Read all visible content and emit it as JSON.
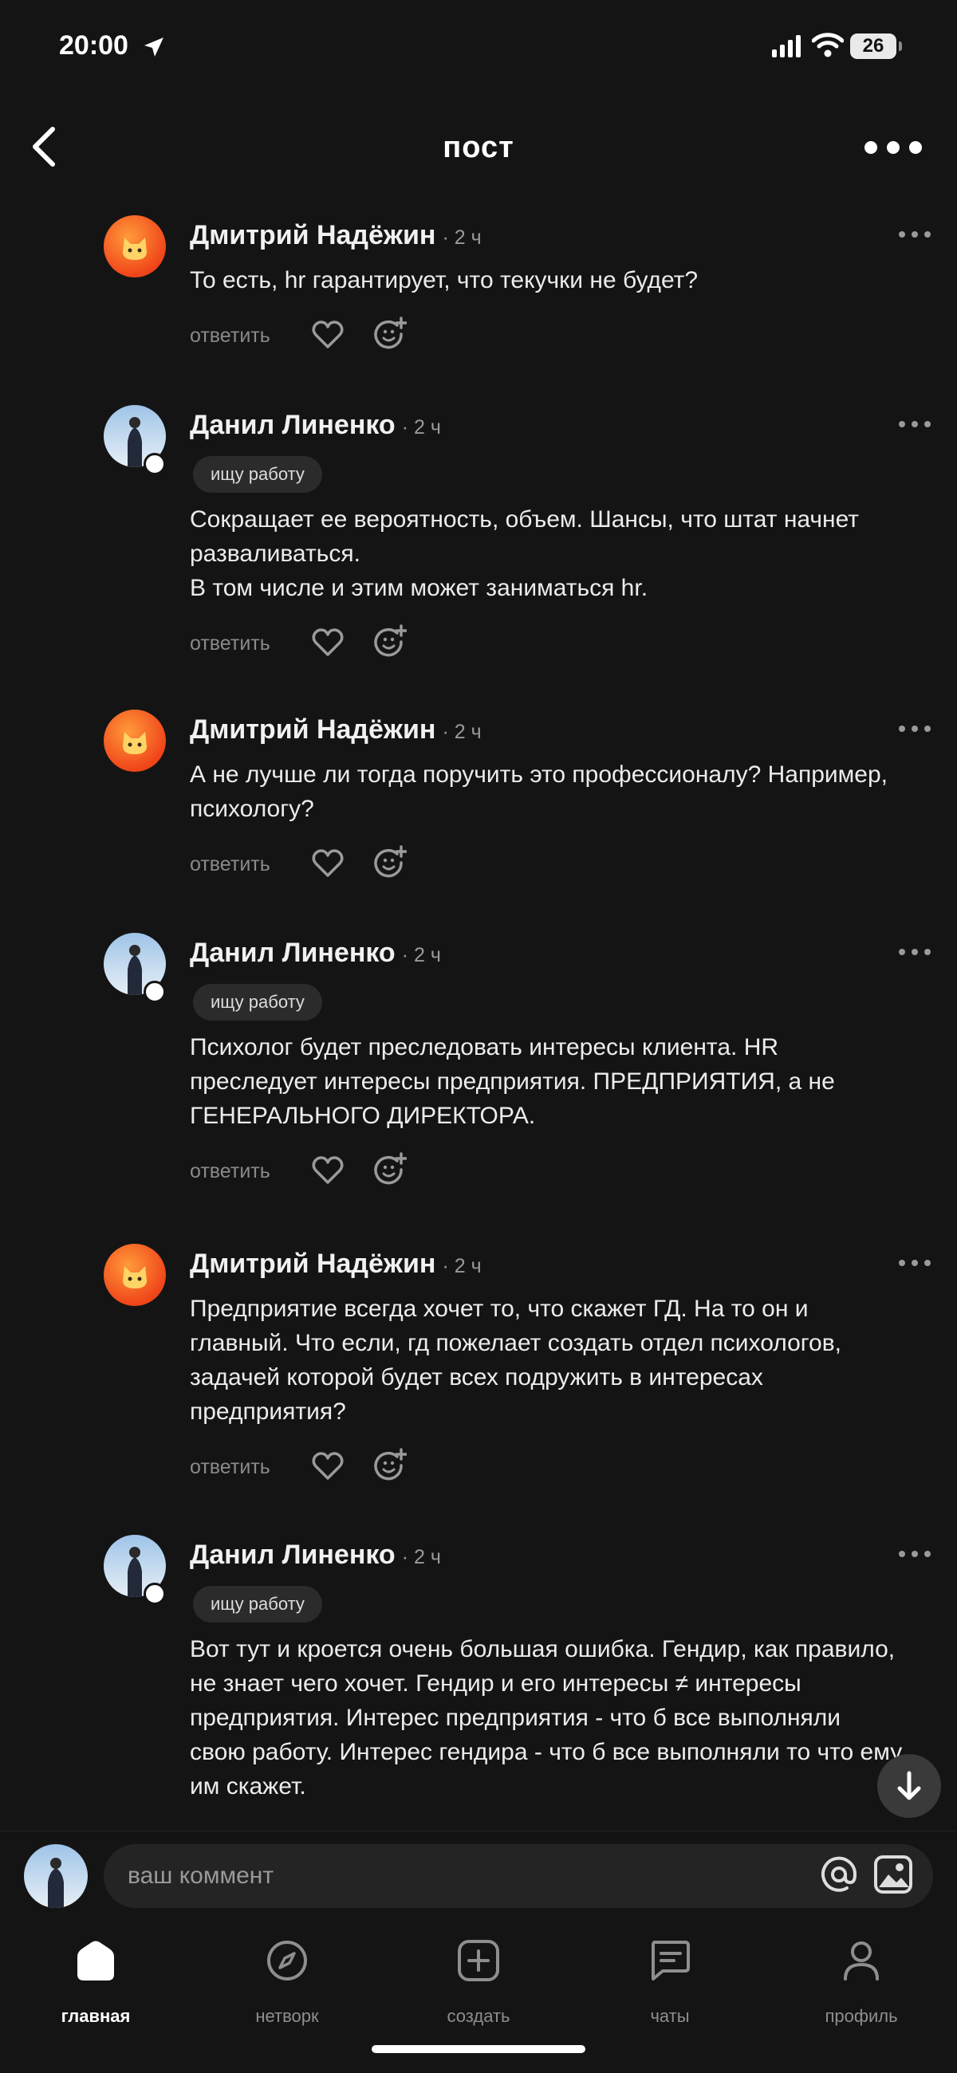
{
  "status_bar": {
    "time": "20:00",
    "battery": "26"
  },
  "header": {
    "title": "пост"
  },
  "comments": [
    {
      "author": "Дмитрий Надёжин",
      "time": "· 2 ч",
      "avatar": "cat-emoji-avatar",
      "tag": "",
      "lines": [
        "То есть, hr гарантирует, что текучки не будет?"
      ]
    },
    {
      "author": "Данил Линенко",
      "time": "· 2 ч",
      "avatar": "photo-avatar",
      "tag": "ищу работу",
      "lines": [
        "Сокращает ее вероятность, объем. Шансы, что штат начнет",
        "разваливаться.",
        "В том числе и этим может заниматься hr."
      ]
    },
    {
      "author": "Дмитрий Надёжин",
      "time": "· 2 ч",
      "avatar": "cat-emoji-avatar",
      "tag": "",
      "lines": [
        "А не лучше ли тогда поручить это профессионалу? Например,",
        "психологу?"
      ]
    },
    {
      "author": "Данил Линенко",
      "time": "· 2 ч",
      "avatar": "photo-avatar",
      "tag": "ищу работу",
      "lines": [
        "Психолог будет преследовать интересы клиента. HR",
        "преследует интересы предприятия. ПРЕДПРИЯТИЯ, а не",
        "ГЕНЕРАЛЬНОГО ДИРЕКТОРА."
      ]
    },
    {
      "author": "Дмитрий Надёжин",
      "time": "· 2 ч",
      "avatar": "cat-emoji-avatar",
      "tag": "",
      "lines": [
        "Предприятие всегда хочет то, что скажет ГД. На то он и",
        "главный. Что если, гд пожелает создать отдел психологов,",
        "задачей которой будет всех подружить в интересах",
        "предприятия?"
      ]
    },
    {
      "author": "Данил Линенко",
      "time": "· 2 ч",
      "avatar": "photo-avatar",
      "tag": "ищу работу",
      "lines": [
        "Вот тут и кроется очень большая ошибка. Гендир, как правило,",
        "не знает чего хочет. Гендир и его интересы ≠ интересы",
        "предприятия. Интерес предприятия - что б все выполняли",
        "свою работу. Интерес гендира - что б все выполняли то что ему",
        "им скажет."
      ]
    }
  ],
  "actions": {
    "reply_label": "ответить"
  },
  "composer": {
    "placeholder": "ваш коммент"
  },
  "tabs": [
    {
      "label": "главная",
      "icon": "home-icon",
      "active": true
    },
    {
      "label": "нетворк",
      "icon": "compass-icon",
      "active": false
    },
    {
      "label": "создать",
      "icon": "plus-square-icon",
      "active": false
    },
    {
      "label": "чаты",
      "icon": "chat-icon",
      "active": false
    },
    {
      "label": "профиль",
      "icon": "profile-icon",
      "active": false
    }
  ]
}
